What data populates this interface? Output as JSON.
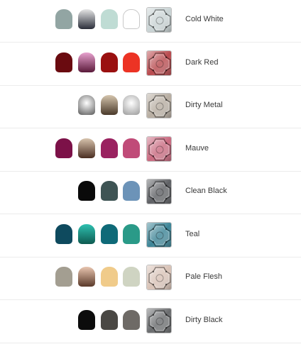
{
  "schemes": [
    {
      "name": "Cold White",
      "thumb_color": "#c9d3d4",
      "pots": [
        {
          "kind": "flat",
          "color": "#92a5a3"
        },
        {
          "kind": "gradient",
          "top": "#e6e6e6",
          "bottom": "#2a2e3a"
        },
        {
          "kind": "flat",
          "color": "#bfdcd4"
        },
        {
          "kind": "outline",
          "color": "#ffffff"
        }
      ]
    },
    {
      "name": "Dark Red",
      "thumb_color": "#b8494d",
      "pots": [
        {
          "kind": "flat",
          "color": "#6a0b10"
        },
        {
          "kind": "gradient",
          "top": "#e8a2cf",
          "bottom": "#5a1a3a"
        },
        {
          "kind": "flat",
          "color": "#9a1010"
        },
        {
          "kind": "flat",
          "color": "#ec3324"
        }
      ]
    },
    {
      "name": "Dirty Metal",
      "thumb_color": "#b7ada1",
      "pots": [
        {
          "kind": "radial",
          "top": "#ffffff",
          "bottom": "#5a5a5a"
        },
        {
          "kind": "gradient",
          "top": "#d6c6ae",
          "bottom": "#4a3a2a"
        },
        {
          "kind": "radial",
          "top": "#ffffff",
          "bottom": "#9a9a9a"
        }
      ]
    },
    {
      "name": "Mauve",
      "thumb_color": "#c9697f",
      "pots": [
        {
          "kind": "flat",
          "color": "#7c1148"
        },
        {
          "kind": "gradient",
          "top": "#d8c4ae",
          "bottom": "#4a2e22"
        },
        {
          "kind": "flat",
          "color": "#9a2260"
        },
        {
          "kind": "flat",
          "color": "#c04b78"
        }
      ]
    },
    {
      "name": "Clean Black",
      "thumb_color": "#5e6064",
      "pots": [
        {
          "kind": "flat",
          "color": "#0a0a0a"
        },
        {
          "kind": "flat",
          "color": "#3e5454"
        },
        {
          "kind": "flat",
          "color": "#6c93b8"
        }
      ]
    },
    {
      "name": "Teal",
      "thumb_color": "#3c8496",
      "pots": [
        {
          "kind": "flat",
          "color": "#0e4a5e"
        },
        {
          "kind": "gradient",
          "top": "#2ec0b0",
          "bottom": "#0e5a50"
        },
        {
          "kind": "flat",
          "color": "#0f6a78"
        },
        {
          "kind": "flat",
          "color": "#2a9a88"
        }
      ]
    },
    {
      "name": "Pale Flesh",
      "thumb_color": "#d8c2b6",
      "pots": [
        {
          "kind": "flat",
          "color": "#a39e91"
        },
        {
          "kind": "gradient",
          "top": "#e9c6b0",
          "bottom": "#5a3a2a"
        },
        {
          "kind": "flat",
          "color": "#f0cb8a"
        },
        {
          "kind": "flat",
          "color": "#cfd4c2"
        }
      ]
    },
    {
      "name": "Dirty Black",
      "thumb_color": "#6a6c6e",
      "pots": [
        {
          "kind": "flat",
          "color": "#0c0c0c"
        },
        {
          "kind": "flat",
          "color": "#4a4844"
        },
        {
          "kind": "flat",
          "color": "#6e6a66"
        }
      ]
    }
  ]
}
